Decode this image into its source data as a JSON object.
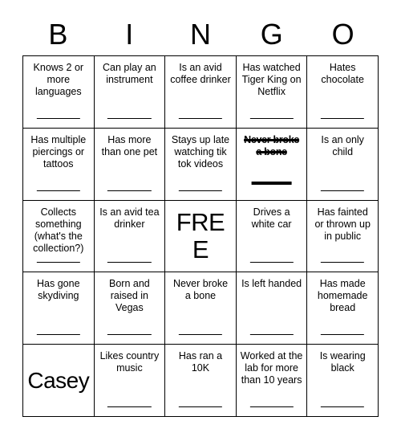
{
  "card": {
    "title": "BINGO",
    "header_letters": [
      "B",
      "I",
      "N",
      "G",
      "O"
    ],
    "free_label": "FREE",
    "signature_name": "Casey",
    "ink_color": "#000000",
    "background_color": "#ffffff",
    "rows": 5,
    "columns": 5,
    "squares": [
      {
        "text": "Knows 2 or more languages",
        "state": "open",
        "line": true
      },
      {
        "text": "Can play an instrument",
        "state": "open",
        "line": true
      },
      {
        "text": "Is an avid coffee drinker",
        "state": "open",
        "line": true
      },
      {
        "text": "Has watched Tiger King on Netflix",
        "state": "open",
        "line": true
      },
      {
        "text": "Hates chocolate",
        "state": "open",
        "line": true
      },
      {
        "text": "Has multiple piercings or tattoos",
        "state": "open",
        "line": true
      },
      {
        "text": "Has more than one pet",
        "state": "open",
        "line": true
      },
      {
        "text": "Stays up late watching tik tok videos",
        "state": "open",
        "line": true
      },
      {
        "text": "Never broke a bone",
        "state": "marked",
        "line": true
      },
      {
        "text": "Is an only child",
        "state": "open",
        "line": true
      },
      {
        "text": "Collects something (what's the collection?)",
        "state": "open",
        "line": true
      },
      {
        "text": "Is an avid tea drinker",
        "state": "open",
        "line": true
      },
      {
        "text": "FREE",
        "state": "free",
        "line": false
      },
      {
        "text": "Drives a white car",
        "state": "open",
        "line": true
      },
      {
        "text": "Has fainted or thrown up in public",
        "state": "open",
        "line": true
      },
      {
        "text": "Has gone skydiving",
        "state": "open",
        "line": true
      },
      {
        "text": "Born and raised in Vegas",
        "state": "open",
        "line": true
      },
      {
        "text": "Never broke a bone",
        "state": "open",
        "line": true
      },
      {
        "text": "Is left handed",
        "state": "open",
        "line": true
      },
      {
        "text": "Has made homemade bread",
        "state": "open",
        "line": true
      },
      {
        "text": "Casey",
        "state": "signed",
        "line": false
      },
      {
        "text": "Likes country music",
        "state": "open",
        "line": true
      },
      {
        "text": "Has ran a 10K",
        "state": "open",
        "line": true
      },
      {
        "text": "Worked at the lab for more than 10 years",
        "state": "open",
        "line": true
      },
      {
        "text": "Is wearing black",
        "state": "open",
        "line": true
      }
    ]
  }
}
